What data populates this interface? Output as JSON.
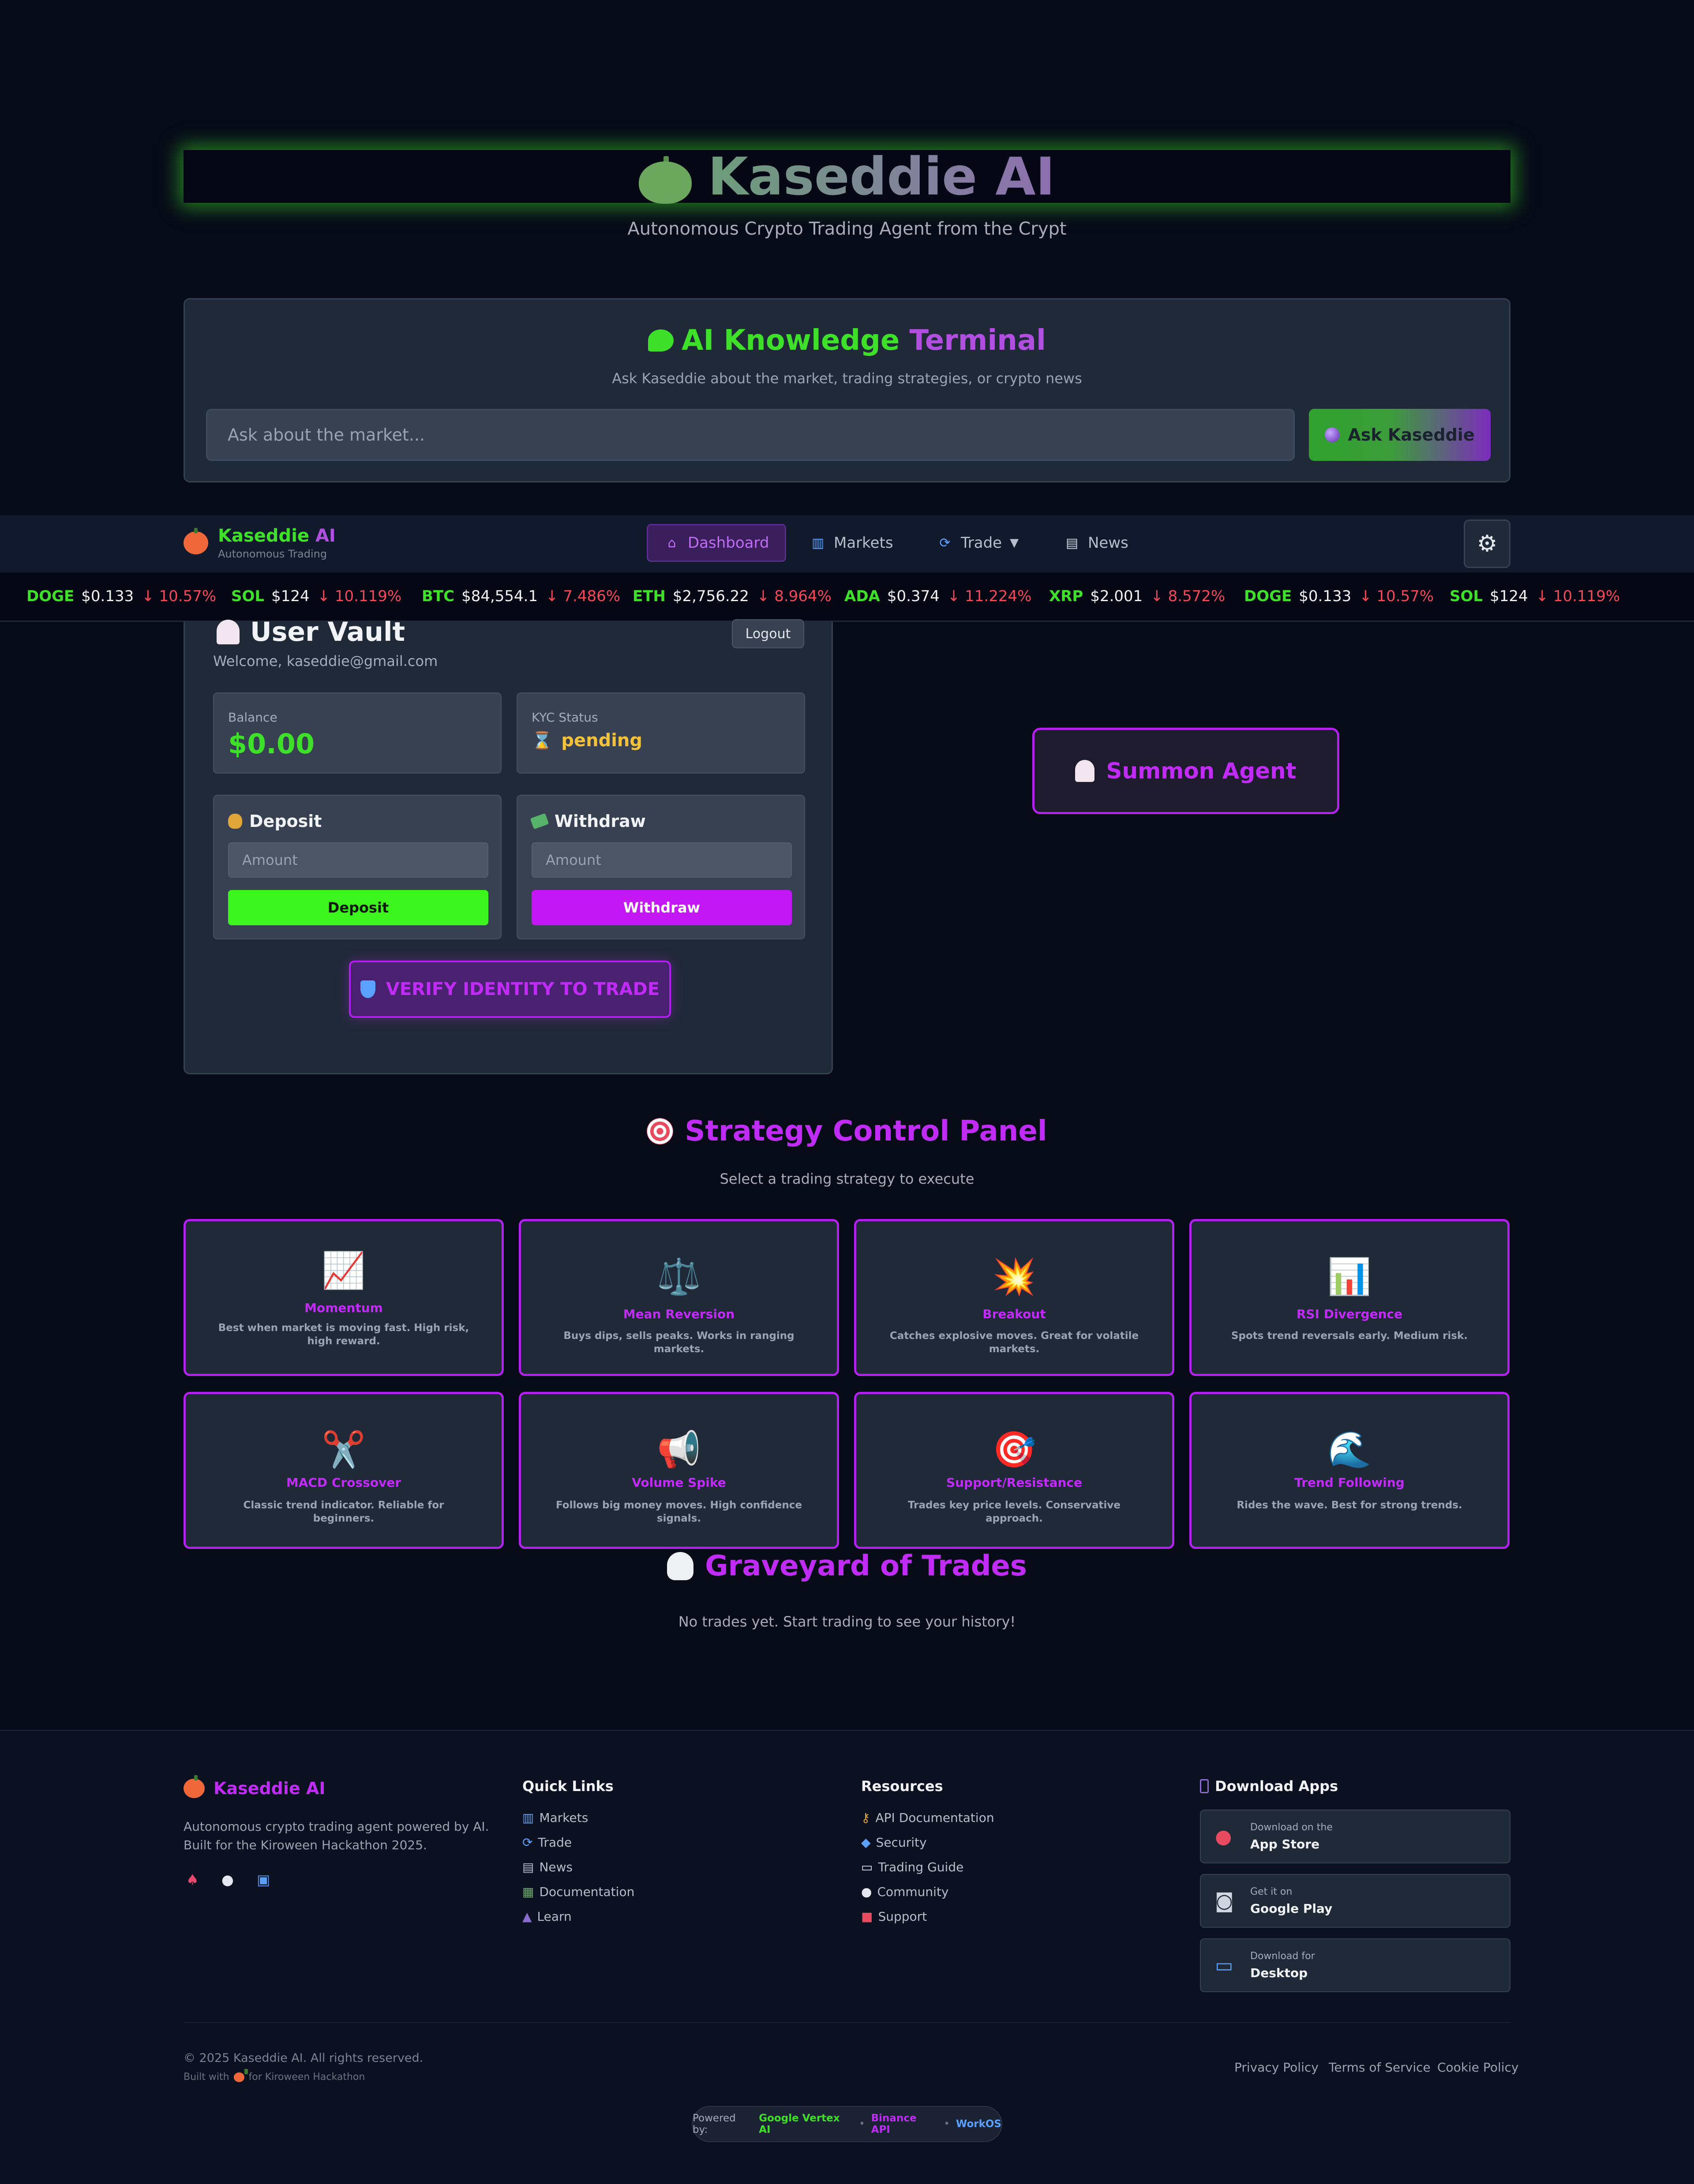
{
  "hero": {
    "title": "Kaseddie AI",
    "subtitle": "Autonomous Crypto Trading Agent from the Crypt"
  },
  "terminal": {
    "title_part1": "AI Knowledge",
    "title_part2": "Terminal",
    "icon": "speech-bubble-icon",
    "subtitle": "Ask Kaseddie about the market, trading strategies, or crypto news",
    "input_placeholder": "Ask about the market...",
    "button_label": "Ask Kaseddie",
    "button_icon": "crystal-ball-icon"
  },
  "nav": {
    "brand_part1": "Kaseddie",
    "brand_part2": "AI",
    "brand_sub": "Autonomous Trading",
    "items": [
      {
        "label": "Dashboard",
        "icon": "house-icon",
        "active": true
      },
      {
        "label": "Markets",
        "icon": "bar-chart-icon",
        "active": false
      },
      {
        "label": "Trade",
        "icon": "cycle-arrows-icon",
        "active": false,
        "has_dropdown": true
      },
      {
        "label": "News",
        "icon": "newspaper-icon",
        "active": false
      }
    ],
    "settings_icon": "gear-icon"
  },
  "ticker": [
    {
      "symbol": "DOGE",
      "price": "$0.133",
      "change": "↓ 10.57%"
    },
    {
      "symbol": "SOL",
      "price": "$124",
      "change": "↓ 10.119%"
    },
    {
      "symbol": "BTC",
      "price": "$84,554.1",
      "change": "↓ 7.486%"
    },
    {
      "symbol": "ETH",
      "price": "$2,756.22",
      "change": "↓ 8.964%"
    },
    {
      "symbol": "ADA",
      "price": "$0.374",
      "change": "↓ 11.224%"
    },
    {
      "symbol": "XRP",
      "price": "$2.001",
      "change": "↓ 8.572%"
    },
    {
      "symbol": "DOGE",
      "price": "$0.133",
      "change": "↓ 10.57%"
    },
    {
      "symbol": "SOL",
      "price": "$124",
      "change": "↓ 10.119%"
    }
  ],
  "vault": {
    "title": "User Vault",
    "logout_label": "Logout",
    "welcome": "Welcome, kaseddie@gmail.com",
    "balance_label": "Balance",
    "balance_value": "$0.00",
    "kyc_label": "KYC Status",
    "kyc_value": "pending",
    "deposit_title": "Deposit",
    "deposit_placeholder": "Amount",
    "deposit_button": "Deposit",
    "withdraw_title": "Withdraw",
    "withdraw_placeholder": "Amount",
    "withdraw_button": "Withdraw",
    "verify_button": "VERIFY IDENTITY TO TRADE"
  },
  "summon": {
    "label": "Summon Agent"
  },
  "strategy": {
    "title": "Strategy Control Panel",
    "subtitle": "Select a trading strategy to execute",
    "cards": [
      {
        "name": "Momentum",
        "desc": "Best when market is moving fast. High risk, high reward.",
        "icon": "chart-increasing-icon",
        "emoji": "📈"
      },
      {
        "name": "Mean Reversion",
        "desc": "Buys dips, sells peaks. Works in ranging markets.",
        "icon": "balance-scale-icon",
        "emoji": "⚖️"
      },
      {
        "name": "Breakout",
        "desc": "Catches explosive moves. Great for volatile markets.",
        "icon": "explosion-icon",
        "emoji": "💥"
      },
      {
        "name": "RSI Divergence",
        "desc": "Spots trend reversals early. Medium risk.",
        "icon": "bar-chart-icon",
        "emoji": "📊"
      },
      {
        "name": "MACD Crossover",
        "desc": "Classic trend indicator. Reliable for beginners.",
        "icon": "scissors-icon",
        "emoji": "✂️"
      },
      {
        "name": "Volume Spike",
        "desc": "Follows big money moves. High confidence signals.",
        "icon": "megaphone-icon",
        "emoji": "📢"
      },
      {
        "name": "Support/Resistance",
        "desc": "Trades key price levels. Conservative approach.",
        "icon": "target-icon",
        "emoji": "🎯"
      },
      {
        "name": "Trend Following",
        "desc": "Rides the wave. Best for strong trends.",
        "icon": "wave-icon",
        "emoji": "🌊"
      }
    ]
  },
  "graveyard": {
    "title": "Graveyard of Trades",
    "empty": "No trades yet. Start trading to see your history!"
  },
  "footer": {
    "brand": "Kaseddie AI",
    "desc": "Autonomous crypto trading agent powered by AI. Built for the Kiroween Hackathon 2025.",
    "quick_links_title": "Quick Links",
    "quick_links": [
      {
        "label": "Markets",
        "icon": "bar-chart-icon"
      },
      {
        "label": "Trade",
        "icon": "cycle-arrows-icon"
      },
      {
        "label": "News",
        "icon": "newspaper-icon"
      },
      {
        "label": "Documentation",
        "icon": "books-icon"
      },
      {
        "label": "Learn",
        "icon": "graduation-cap-icon"
      }
    ],
    "resources_title": "Resources",
    "resources": [
      {
        "label": "API Documentation",
        "icon": "key-icon"
      },
      {
        "label": "Security",
        "icon": "shield-icon"
      },
      {
        "label": "Trading Guide",
        "icon": "book-icon"
      },
      {
        "label": "Community",
        "icon": "speech-bubble-icon"
      },
      {
        "label": "Support",
        "icon": "sos-icon"
      }
    ],
    "apps_title": "Download Apps",
    "apps": [
      {
        "small": "Download on the",
        "big": "App Store",
        "icon": "apple-icon"
      },
      {
        "small": "Get it on",
        "big": "Google Play",
        "icon": "robot-icon"
      },
      {
        "small": "Download for",
        "big": "Desktop",
        "icon": "laptop-icon"
      }
    ],
    "copyright": "© 2025 Kaseddie AI. All rights reserved.",
    "built_prefix": "Built with",
    "built_suffix": "for Kiroween Hackathon",
    "legal": [
      "Privacy Policy",
      "Terms of Service",
      "Cookie Policy"
    ],
    "powered_label": "Powered by:",
    "powered": [
      "Google Vertex AI",
      "Binance API",
      "WorkOS"
    ]
  }
}
